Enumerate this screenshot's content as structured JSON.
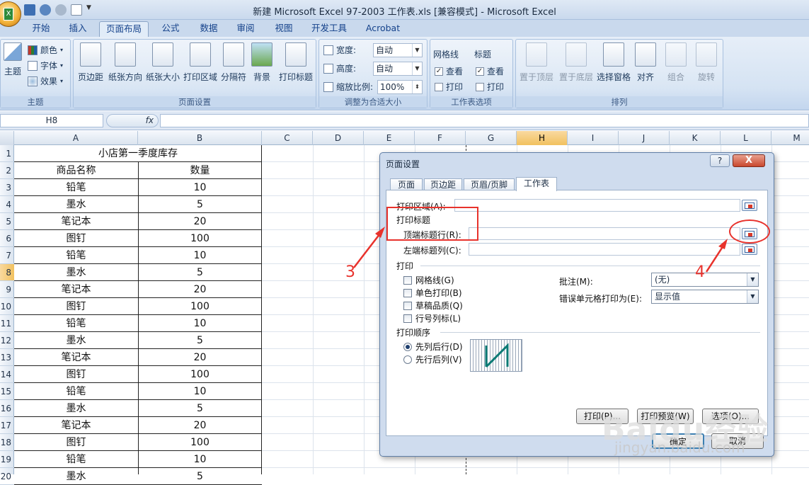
{
  "window": {
    "title": "新建 Microsoft Excel 97-2003 工作表.xls  [兼容模式] - Microsoft Excel"
  },
  "tabs": [
    "开始",
    "插入",
    "页面布局",
    "公式",
    "数据",
    "审阅",
    "视图",
    "开发工具",
    "Acrobat"
  ],
  "active_tab": "页面布局",
  "ribbon": {
    "theme": {
      "label": "主题",
      "main": "主题",
      "colors": "颜色",
      "fonts": "字体",
      "effects": "效果"
    },
    "page_setup": {
      "label": "页面设置",
      "buttons": [
        "页边距",
        "纸张方向",
        "纸张大小",
        "打印区域",
        "分隔符",
        "背景",
        "打印标题"
      ]
    },
    "scale": {
      "label": "调整为合适大小",
      "width_label": "宽度:",
      "width_value": "自动",
      "height_label": "高度:",
      "height_value": "自动",
      "scale_label": "缩放比例:",
      "scale_value": "100%"
    },
    "sheet_options": {
      "label": "工作表选项",
      "gridlines": "网格线",
      "headings": "标题",
      "view": "查看",
      "print": "打印"
    },
    "arrange": {
      "label": "排列",
      "buttons": [
        "置于顶层",
        "置于底层",
        "选择窗格",
        "对齐",
        "组合",
        "旋转"
      ]
    }
  },
  "formula_bar": {
    "name_box": "H8",
    "fx": "fx",
    "value": ""
  },
  "columns": [
    "A",
    "B",
    "C",
    "D",
    "E",
    "F",
    "G",
    "H",
    "I",
    "J",
    "K",
    "L",
    "M"
  ],
  "selected_column": "H",
  "rows": [
    "1",
    "2",
    "3",
    "4",
    "5",
    "6",
    "7",
    "8",
    "9",
    "10",
    "11",
    "12",
    "13",
    "14",
    "15",
    "16",
    "17",
    "18",
    "19",
    "20"
  ],
  "selected_row": "8",
  "sheet": {
    "title": "小店第一季度库存",
    "headers": [
      "商品名称",
      "数量"
    ],
    "data": [
      [
        "铅笔",
        "10"
      ],
      [
        "墨水",
        "5"
      ],
      [
        "笔记本",
        "20"
      ],
      [
        "图钉",
        "100"
      ],
      [
        "铅笔",
        "10"
      ],
      [
        "墨水",
        "5"
      ],
      [
        "笔记本",
        "20"
      ],
      [
        "图钉",
        "100"
      ],
      [
        "铅笔",
        "10"
      ],
      [
        "墨水",
        "5"
      ],
      [
        "笔记本",
        "20"
      ],
      [
        "图钉",
        "100"
      ],
      [
        "铅笔",
        "10"
      ],
      [
        "墨水",
        "5"
      ],
      [
        "笔记本",
        "20"
      ],
      [
        "图钉",
        "100"
      ],
      [
        "铅笔",
        "10"
      ],
      [
        "墨水",
        "5"
      ]
    ]
  },
  "dialog": {
    "title": "页面设置",
    "help": "?",
    "close": "X",
    "tabs": [
      "页面",
      "页边距",
      "页眉/页脚",
      "工作表"
    ],
    "active_tab": "工作表",
    "print_area_label": "打印区域(A):",
    "print_titles_label": "打印标题",
    "rows_to_repeat_label": "顶端标题行(R):",
    "cols_to_repeat_label": "左端标题列(C):",
    "print_section_label": "打印",
    "print_options": [
      "网格线(G)",
      "单色打印(B)",
      "草稿品质(Q)",
      "行号列标(L)"
    ],
    "comments_label": "批注(M):",
    "comments_value": "(无)",
    "errors_label": "错误单元格打印为(E):",
    "errors_value": "显示值",
    "order_label": "打印顺序",
    "order_options": [
      "先列后行(D)",
      "先行后列(V)"
    ],
    "buttons": {
      "print": "打印(P)...",
      "preview": "打印预览(W)",
      "options": "选项(O)...",
      "ok": "确定",
      "cancel": "取消"
    }
  },
  "annotations": {
    "label3": "3",
    "label4": "4",
    "accent": "#e8322c"
  },
  "watermark": {
    "main": "Baidu经验",
    "sub": "jingyan.baidu.com"
  }
}
